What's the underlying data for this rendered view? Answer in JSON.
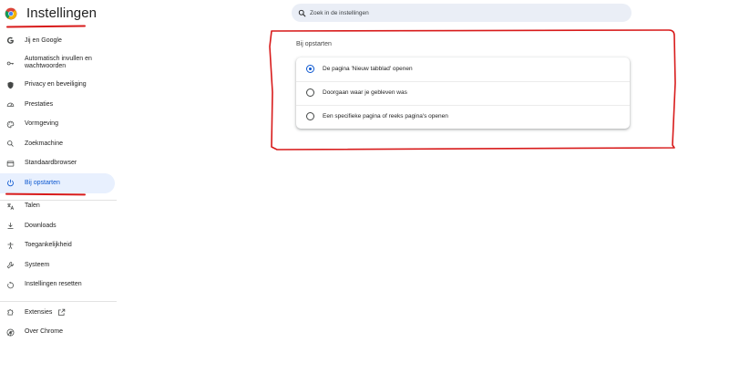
{
  "header": {
    "title": "Instellingen",
    "logo_icon": "chrome-logo-icon"
  },
  "search": {
    "placeholder": "Zoek in de instellingen",
    "icon": "search-icon"
  },
  "sidebar": {
    "items": [
      {
        "label": "Jij en Google",
        "icon": "google-g-icon"
      },
      {
        "label": "Automatisch invullen en wachtwoorden",
        "icon": "key-icon"
      },
      {
        "label": "Privacy en beveiliging",
        "icon": "shield-icon"
      },
      {
        "label": "Prestaties",
        "icon": "speedometer-icon"
      },
      {
        "label": "Vormgeving",
        "icon": "palette-icon"
      },
      {
        "label": "Zoekmachine",
        "icon": "search-icon"
      },
      {
        "label": "Standaardbrowser",
        "icon": "browser-window-icon"
      },
      {
        "label": "Bij opstarten",
        "icon": "power-icon",
        "active": true
      },
      {
        "label": "Talen",
        "icon": "translate-icon"
      },
      {
        "label": "Downloads",
        "icon": "download-icon"
      },
      {
        "label": "Toegankelijkheid",
        "icon": "accessibility-icon"
      },
      {
        "label": "Systeem",
        "icon": "wrench-icon"
      },
      {
        "label": "Instellingen resetten",
        "icon": "reset-icon"
      },
      {
        "label": "Extensies",
        "icon": "puzzle-icon"
      },
      {
        "label": "Over Chrome",
        "icon": "chrome-logo-icon"
      }
    ]
  },
  "main": {
    "section_title": "Bij opstarten",
    "options": [
      {
        "label": "De pagina 'Nieuw tabblad' openen",
        "checked": true
      },
      {
        "label": "Doorgaan waar je gebleven was",
        "checked": false
      },
      {
        "label": "Een specifieke pagina of reeks pagina's openen",
        "checked": false
      }
    ]
  },
  "colors": {
    "accent": "#0b57d0",
    "active_bg": "#e8f0fe",
    "annotation_red": "#d81b1b",
    "search_bg": "#eaeef6"
  }
}
